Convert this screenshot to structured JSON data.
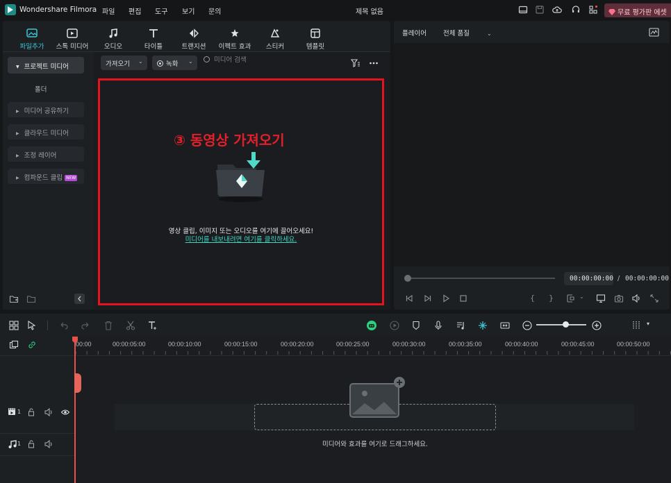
{
  "app": {
    "title": "Wondershare Filmora",
    "document_title": "제목 없음",
    "trial_button": "무료 평가판 에셋"
  },
  "menu": [
    "파일",
    "편집",
    "도구",
    "보기",
    "문의"
  ],
  "toolbar_tabs": [
    {
      "label": "파일추가",
      "icon": "media-icon",
      "active": true
    },
    {
      "label": "스톡 미디어",
      "icon": "stock-media-icon"
    },
    {
      "label": "오디오",
      "icon": "music-note-icon"
    },
    {
      "label": "타이틀",
      "icon": "title-text-icon"
    },
    {
      "label": "트랜지션",
      "icon": "transition-icon"
    },
    {
      "label": "이펙트 효과",
      "icon": "effects-icon"
    },
    {
      "label": "스티커",
      "icon": "sticker-icon"
    },
    {
      "label": "템플릿",
      "icon": "template-icon"
    }
  ],
  "sidebar": {
    "project_media": "프로젝트 미디어",
    "folder": "폴더",
    "items": [
      {
        "label": "미디어 공유하기"
      },
      {
        "label": "클라우드 미디어"
      },
      {
        "label": "조정 레이어"
      },
      {
        "label": "컴파운드 클립",
        "badge": "NEW"
      }
    ]
  },
  "media_toolbar": {
    "import_label": "가져오기",
    "record_label": "녹화",
    "search_placeholder": "미디어 검색"
  },
  "annotation": "③ 동영상 가져오기",
  "dropzone": {
    "line1": "영상 클립, 이미지 또는 오디오를 여기에 끌어오세요!",
    "line2": "미디어를 내보내려면 여기를 클릭하세요."
  },
  "player": {
    "label": "플레이어",
    "quality": "전체 품질",
    "current_time": "00:00:00:00",
    "separator": "/",
    "total_time": "00:00:00:00"
  },
  "timeline": {
    "ruler_ticks": [
      "00:00",
      "00:00:05:00",
      "00:00:10:00",
      "00:00:15:00",
      "00:00:20:00",
      "00:00:25:00",
      "00:00:30:00",
      "00:00:35:00",
      "00:00:40:00",
      "00:00:45:00",
      "00:00:50:00"
    ],
    "drop_hint": "미디어와 효과를 여기로 드래그하세요.",
    "tracks": [
      {
        "type": "video",
        "number": "1"
      },
      {
        "type": "audio",
        "number": "1"
      }
    ]
  },
  "colors": {
    "accent": "#3cc8d6",
    "annotation_red": "#e3141b",
    "playhead": "#e8514a",
    "link": "#3fd6c0"
  }
}
